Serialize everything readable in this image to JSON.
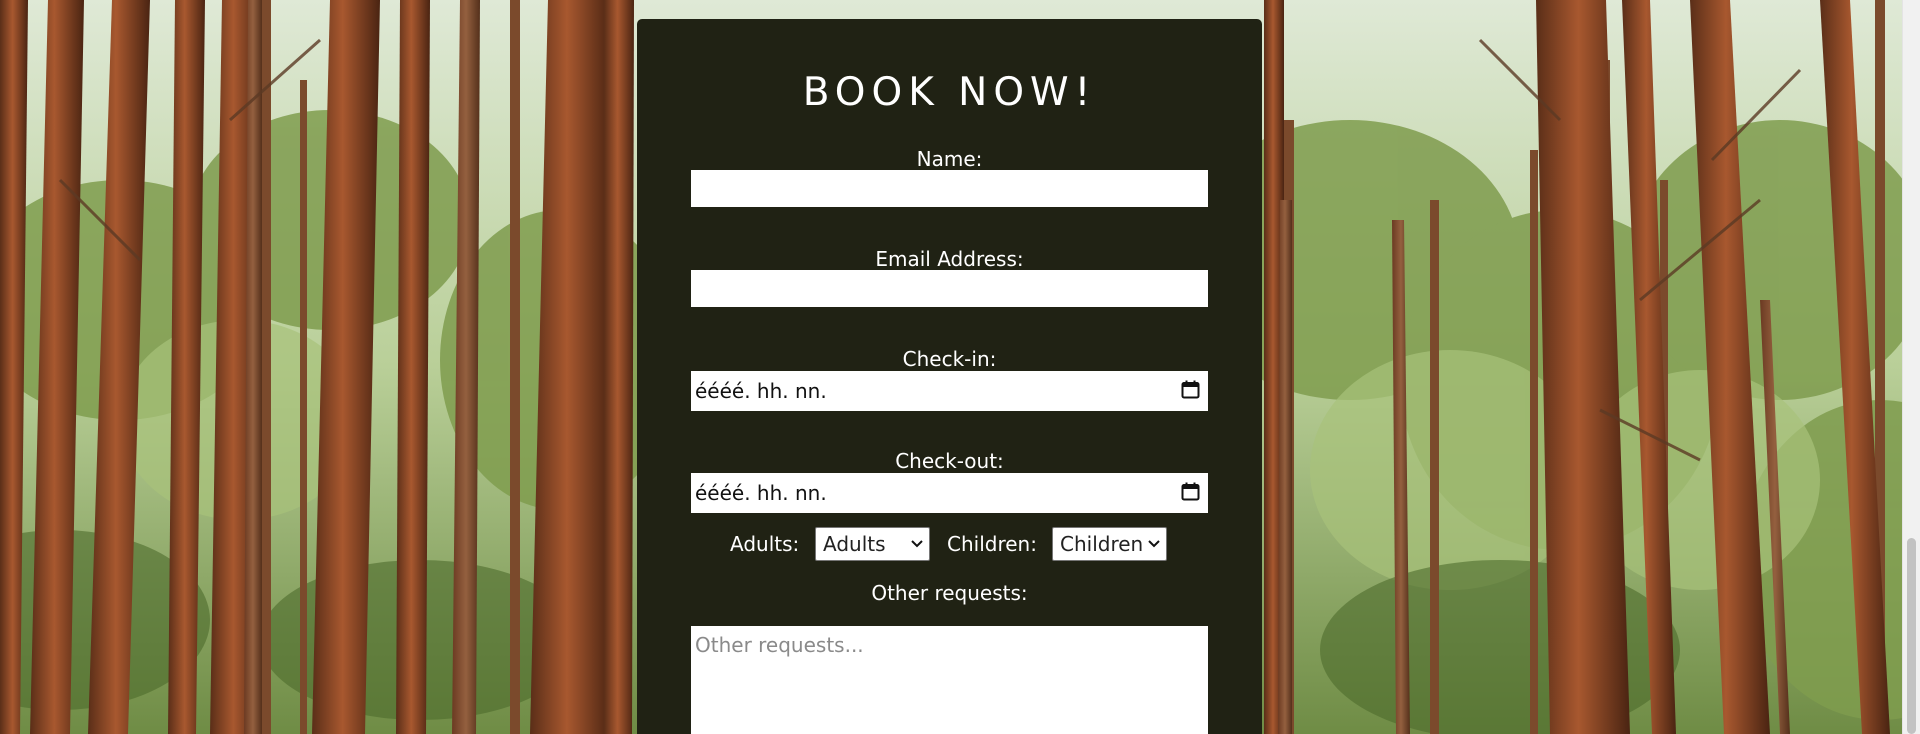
{
  "booking": {
    "title": "BOOK NOW!",
    "name_label": "Name:",
    "name_value": "",
    "email_label": "Email Address:",
    "email_value": "",
    "checkin_label": "Check-in:",
    "checkin_value": "éééé. hh. nn.",
    "checkout_label": "Check-out:",
    "checkout_value": "éééé. hh. nn.",
    "adults_label": "Adults:",
    "adults_selected": "Adults",
    "children_label": "Children:",
    "children_selected": "Children",
    "requests_label": "Other requests:",
    "requests_placeholder": "Other requests..."
  },
  "icons": {
    "calendar": "calendar-icon",
    "select_arrow": "chevron-down-icon"
  },
  "colors": {
    "card_background": "#202214",
    "card_text": "#ffffff",
    "input_background": "#ffffff"
  }
}
